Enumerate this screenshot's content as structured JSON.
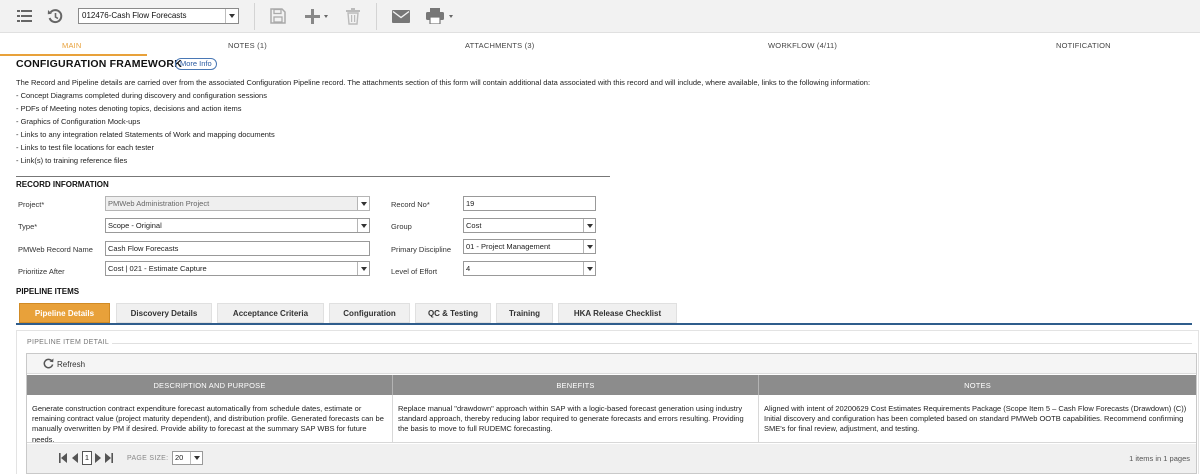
{
  "toolbar": {
    "record_selector_value": "012476-Cash Flow Forecasts",
    "icons": [
      "list-icon",
      "history-icon",
      "save-icon",
      "add-icon",
      "delete-icon",
      "email-icon",
      "print-icon"
    ]
  },
  "tabs": [
    {
      "label": "MAIN",
      "active": true
    },
    {
      "label": "NOTES (1)",
      "active": false
    },
    {
      "label": "ATTACHMENTS (3)",
      "active": false
    },
    {
      "label": "WORKFLOW (4/11)",
      "active": false
    },
    {
      "label": "NOTIFICATION",
      "active": false
    }
  ],
  "config": {
    "title": "CONFIGURATION FRAMEWORK",
    "more_info": "More Info",
    "intro": "The Record and Pipeline details are carried over from the associated Configuration Pipeline record.  The attachments section of  this form will contain additional data associated with this record and will include, where available, links to the following information:",
    "bullets": [
      "- Concept Diagrams completed during discovery and configuration sessions",
      "- PDFs of Meeting notes denoting topics, decisions and action items",
      "- Graphics of Configuration Mock-ups",
      "- Links to any integration related Statements of Work and mapping documents",
      "- Links to test file locations for each tester",
      "- Link(s) to training reference files"
    ]
  },
  "record": {
    "section_title": "RECORD INFORMATION",
    "project_label": "Project*",
    "project_value": "PMWeb Administration Project",
    "type_label": "Type*",
    "type_value": "Scope - Original",
    "name_label": "PMWeb Record Name",
    "name_value": "Cash Flow Forecasts",
    "prioritize_label": "Prioritize After",
    "prioritize_value": "Cost | 021 - Estimate Capture",
    "record_no_label": "Record No*",
    "record_no_value": "19",
    "group_label": "Group",
    "group_value": "Cost",
    "discipline_label": "Primary Discipline",
    "discipline_value": "01 - Project Management",
    "effort_label": "Level of Effort",
    "effort_value": "4"
  },
  "pipeline": {
    "section_title": "PIPELINE ITEMS",
    "tabs": [
      {
        "label": "Pipeline Details",
        "active": true
      },
      {
        "label": "Discovery Details",
        "active": false
      },
      {
        "label": "Acceptance Criteria",
        "active": false
      },
      {
        "label": "Configuration",
        "active": false
      },
      {
        "label": "QC & Testing",
        "active": false
      },
      {
        "label": "Training",
        "active": false
      },
      {
        "label": "HKA Release Checklist",
        "active": false
      }
    ],
    "detail_title": "PIPELINE ITEM DETAIL",
    "refresh_label": "Refresh",
    "columns": [
      "DESCRIPTION AND PURPOSE",
      "BENEFITS",
      "NOTES"
    ],
    "row": {
      "description": "Generate construction contract expenditure forecast automatically from schedule dates, estimate or remaining contract value (project maturity dependent), and distribution profile. Generated forecasts can be manually overwritten by PM if desired. Provide ability to forecast at the summary SAP WBS for future needs.",
      "benefits": "Replace manual \"drawdown\" approach within SAP with a logic-based forecast generation using industry standard approach, thereby reducing labor required to generate forecasts and errors resulting. Providing the basis to move to full RUDEMC forecasting.",
      "notes": "Aligned with intent of 20200629 Cost Estimates Requirements Package (Scope Item 5 – Cash Flow Forecasts (Drawdown) (C)) Initial discovery and configuration has been completed based on standard PMWeb OOTB capabilities. Recommend confirming SME's for final review, adjustment, and testing."
    },
    "pager": {
      "current_page": "1",
      "page_size_label": "PAGE SIZE:",
      "page_size_value": "20",
      "info": "1 items in 1 pages"
    }
  },
  "colors": {
    "accent": "#e8a13a",
    "tab_rule": "#2f5d8c",
    "grid_header": "#8c8c8c"
  }
}
